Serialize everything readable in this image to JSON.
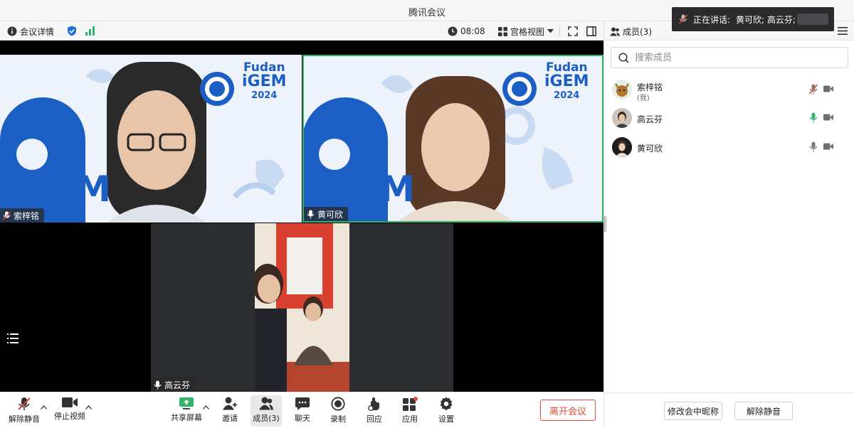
{
  "app": {
    "title": "腾讯会议"
  },
  "topbar": {
    "meeting_info": "会议详情",
    "timer": "08:08",
    "view_mode": "宫格视图"
  },
  "speaking": {
    "label": "正在讲话:",
    "names": "黄可欣; 高云芬;"
  },
  "sidebar": {
    "header": "成员(3)",
    "search_placeholder": "搜索成员",
    "members": [
      {
        "name": "索梓铭",
        "sub": "(我)",
        "mic": "muted",
        "camera": "off"
      },
      {
        "name": "高云芬",
        "sub": "",
        "mic": "speaking",
        "camera": "off"
      },
      {
        "name": "黄可欣",
        "sub": "",
        "mic": "on",
        "camera": "off"
      }
    ],
    "rename_button": "修改会中昵称",
    "unmute_button": "解除静音"
  },
  "videos": [
    {
      "name": "索梓铭",
      "banner_a": "Fudan",
      "banner_b": "iGEM",
      "banner_c": "2024",
      "big": "iGEM"
    },
    {
      "name": "黄可欣",
      "banner_a": "Fudan",
      "banner_b": "iGEM",
      "banner_c": "2024",
      "big": "iGEM"
    },
    {
      "name": "高云芬"
    }
  ],
  "controls": {
    "unmute": "解除静音",
    "stop_video": "停止视频",
    "share": "共享屏幕",
    "invite": "邀请",
    "members": "成员(3)",
    "chat": "聊天",
    "record": "录制",
    "react": "回应",
    "apps": "应用",
    "settings": "设置",
    "leave": "离开会议"
  },
  "colors": {
    "accent_green": "#2fb36b",
    "leave_red": "#e04a3a",
    "brand_blue": "#1f6fd6"
  }
}
